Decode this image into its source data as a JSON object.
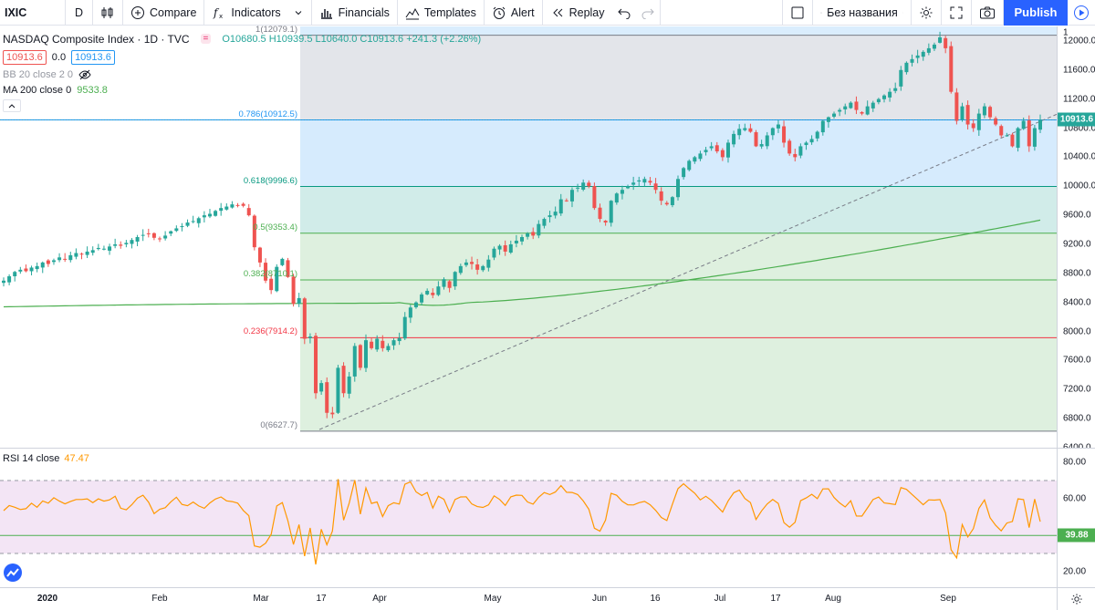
{
  "toolbar": {
    "symbol": "IXIC",
    "interval": "D",
    "compare": "Compare",
    "indicators": "Indicators",
    "financials": "Financials",
    "templates": "Templates",
    "alert": "Alert",
    "replay": "Replay",
    "layout_name": "Без названия",
    "publish": "Publish"
  },
  "legend": {
    "title": "NASDAQ Composite Index · 1D · TVC",
    "ohlc": "O10680.5 H10939.5 L10640.0 C10913.6 +241.3 (+2.26%)",
    "bid": "10913.6",
    "spread": "0.0",
    "ask": "10913.6",
    "bb": "BB 20 close 2 0",
    "ma_label": "MA 200 close 0",
    "ma_value": "9533.8"
  },
  "rsi_legend": {
    "label": "RSI 14 close",
    "value": "47.47"
  },
  "price_axis": {
    "ticks": [
      "12000.0",
      "11600.0",
      "11200.0",
      "10800.0",
      "10400.0",
      "10000.0",
      "9600.0",
      "9200.0",
      "8800.0",
      "8400.0",
      "8000.0",
      "7600.0",
      "7200.0",
      "6800.0",
      "6400.0"
    ],
    "top_partial": "1",
    "current_price": "10913.6"
  },
  "rsi_axis": {
    "ticks": [
      "80.00",
      "60.00",
      "20.00"
    ],
    "current": "39.88"
  },
  "time_axis": [
    "2020",
    "Feb",
    "Mar",
    "17",
    "Apr",
    "May",
    "Jun",
    "16",
    "Jul",
    "17",
    "Aug",
    "Sep"
  ],
  "fib_levels": [
    {
      "label": "1(12079.1)",
      "price": 12079.1,
      "color": "#787b86"
    },
    {
      "label": "0.786(10912.5)",
      "price": 10912.5,
      "color": "#2196f3"
    },
    {
      "label": "0.618(9996.6)",
      "price": 9996.6,
      "color": "#089981"
    },
    {
      "label": "0.5(9353.4)",
      "price": 9353.4,
      "color": "#4caf50"
    },
    {
      "label": "0.382(8710.1)",
      "price": 8710.1,
      "color": "#4caf50"
    },
    {
      "label": "0.236(7914.2)",
      "price": 7914.2,
      "color": "#f23645"
    },
    {
      "label": "0(6627.7)",
      "price": 6627.7,
      "color": "#787b86"
    }
  ],
  "colors": {
    "up": "#26a69a",
    "down": "#ef5350",
    "accent": "#2962ff",
    "ma": "#4caf50",
    "rsi": "#ff9800"
  },
  "chart_data": {
    "type": "candlestick",
    "scale": {
      "price_min": 6400,
      "price_max": 12200
    },
    "closes": [
      8700,
      8760,
      8820,
      8850,
      8830,
      8880,
      8900,
      8950,
      8930,
      8980,
      9020,
      9000,
      9050,
      9080,
      9070,
      9100,
      9120,
      9150,
      9140,
      9170,
      9200,
      9180,
      9220,
      9260,
      9300,
      9330,
      9350,
      9290,
      9270,
      9320,
      9380,
      9420,
      9450,
      9500,
      9520,
      9560,
      9600,
      9620,
      9660,
      9700,
      9720,
      9750,
      9740,
      9730,
      9600,
      9160,
      8950,
      8700,
      8570,
      8890,
      9000,
      8750,
      8380,
      8460,
      7900,
      7930,
      7150,
      7290,
      6880,
      6860,
      7500,
      7150,
      7380,
      7800,
      7500,
      7880,
      7770,
      7900,
      7770,
      7800,
      7880,
      7910,
      8200,
      8330,
      8400,
      8510,
      8560,
      8500,
      8620,
      8720,
      8600,
      8820,
      8900,
      8950,
      8930,
      8850,
      8900,
      8990,
      9140,
      9180,
      9100,
      9200,
      9250,
      9300,
      9350,
      9320,
      9480,
      9550,
      9600,
      9650,
      9820,
      9800,
      9950,
      9980,
      10050,
      10000,
      9700,
      9550,
      9500,
      9800,
      9900,
      9950,
      10000,
      10050,
      10080,
      10100,
      10050,
      9950,
      9800,
      9750,
      9850,
      10100,
      10250,
      10350,
      10400,
      10450,
      10500,
      10550,
      10480,
      10400,
      10600,
      10720,
      10790,
      10800,
      10750,
      10550,
      10580,
      10700,
      10800,
      10850,
      10600,
      10450,
      10400,
      10550,
      10600,
      10650,
      10750,
      10900,
      10950,
      11000,
      11050,
      11100,
      11150,
      11050,
      11000,
      11100,
      11150,
      11200,
      11250,
      11300,
      11350,
      11600,
      11700,
      11750,
      11800,
      11850,
      11900,
      11950,
      12050,
      11900,
      11300,
      10900,
      11100,
      10850,
      10800,
      11000,
      11100,
      10950,
      10850,
      10700,
      10700,
      10550,
      10800,
      10900,
      10550,
      10800,
      10913.6
    ],
    "ma200": {
      "start": 8340,
      "mid": 8400,
      "end": 9533.8
    },
    "rsi_range": [
      20,
      80
    ]
  }
}
